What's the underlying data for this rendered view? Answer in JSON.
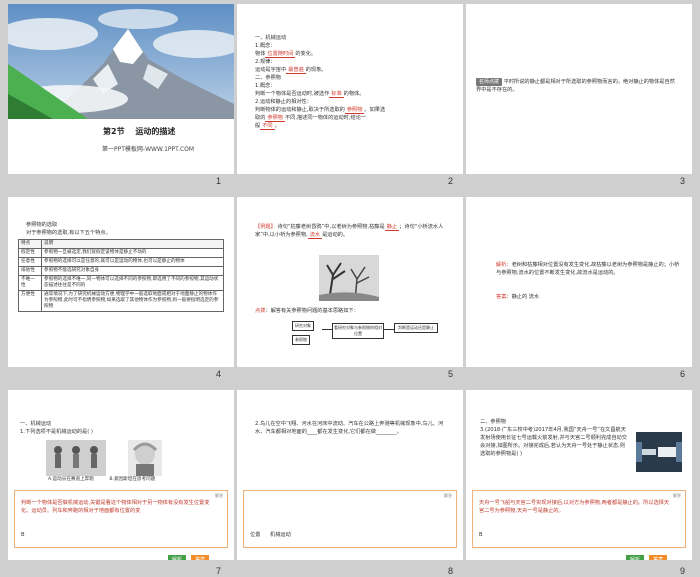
{
  "slide_numbers": [
    "1",
    "2",
    "3",
    "4",
    "5",
    "6",
    "7",
    "8",
    "9"
  ],
  "slide1": {
    "lesson_label": "第2节",
    "lesson_title": "运动的描述",
    "site": "第一PPT模板网-WWW.1PPT.COM"
  },
  "slide2": {
    "heading": "一、机械运动",
    "l1": "1.概念：",
    "l2a": "物体",
    "l2b": "位置随时间",
    "l2c": "的变化。",
    "l3": "2.规律：",
    "l4a": "运动是宇宙中",
    "l4b": "最普遍",
    "l4c": "的现象。",
    "h2": "二、参照物",
    "l5": "1.概念：",
    "l6a": "判断一个物体是否运动时,被选作",
    "l6b": "标准",
    "l6c": "的物体。",
    "l7": "2.运动和静止的相对性：",
    "l8a": "判断物体的运动和静止,取决于所选取的",
    "l8b": "参照物",
    "l8c": "。如果选",
    "l9a": "取的",
    "l9b": "参照物",
    "l9c": "不同,描述同一物体的运动时,结论一",
    "l10a": "般",
    "l10b": "不同",
    "l10c": "。"
  },
  "slide3": {
    "tag": "名师点拨",
    "text": "平时所说的静止都是相对于所选取的参照物而言的，绝对静止的物体是自然界中是不存在的。"
  },
  "slide4": {
    "title": "参照物的选取",
    "intro": "对于参照物的选取,有以下五个特点。",
    "rows": [
      [
        "特点",
        "说明"
      ],
      [
        "假定性",
        "参照物一旦被选定,我们就假定该物体是静止不动的"
      ],
      [
        "任意性",
        "参照物的选择可以是任意的,既可以是运动的物体,也可以是静止的物体"
      ],
      [
        "排他性",
        "参照物不能选研究对象自身"
      ],
      [
        "不唯一性",
        "参照物的选择不唯一,同一物体可以选择不同的参照物,即选用了不同的参照物,其运动状态描述往往是不同的"
      ],
      [
        "方便性",
        "通常情况下,为了研究机械运动方便,物理学中一般选取地面或相对于地面静止的物体作为参照物,此时可不指明参照物,如果选取了其他物体作为参照物,则一般要指明选定的参照物"
      ]
    ]
  },
  "slide5": {
    "tag": "【例题】",
    "text1": "诗句“枯藤老树昏鸦”中,以老树为参照物,枯藤是",
    "blank1": "静止",
    "text2": "；诗句“小桥流水人家”中,以小桥为参照物,",
    "blank2": "流水",
    "text3": "是运动的。",
    "think_tag": "点拨",
    "think_text": "：解答有关参照物问题的基本思路如下：",
    "flow": [
      "研究对象",
      "参照物",
      "看研究对象与参照物的相对位置",
      "判断是运动还是静止"
    ]
  },
  "slide6": {
    "jiexi_label": "解析",
    "jiexi_text": "：老树和枯藤相对位置没有发生变化,故枯藤以老树为参照物是静止的；小桥与参照物,流水的位置不断发生变化,故流水是运动的。",
    "answer_label": "答案",
    "answer_text": "：静止的   流水"
  },
  "slide7": {
    "heading": "一、机械运动",
    "question": "1.下列选项不是机械运动的是(    )",
    "caption_a": "A.运动员在赛道上奔跑",
    "caption_b": "B.爱因斯坦在思考问题",
    "note_label": "解答",
    "explain": "判断一个物体是否做机械运动,关键是看这个物体相对于另一物体有没有发生位置变化。运动员、列车和奔跑的相对于地面都有位置的变",
    "answer": "B",
    "btn_jiexi": "解析",
    "btn_daan": "答案"
  },
  "slide8": {
    "question": "2.鸟儿在空中飞翔、河水在河床中流动、汽车在公路上奔驰等机械现象中,鸟儿、河水、汽车都相对地面的",
    "blank": "____",
    "question_end": "都在发生变化,它们都在做",
    "blank2": "________",
    "period": "。",
    "note_label": "解答",
    "answer1": "位置",
    "answer2": "机械运动"
  },
  "slide9": {
    "heading": "二、参照物",
    "question": "3.(2018·广东三校中考)2017年4月,我国“天舟一号”在文昌航天发射场使用长征七号运载火箭发射,并与天宫二号顺利完成自动交会对接,如图所示。对接完成后,若认为天舟一号处于静止状态,则选取的参照物是(    )",
    "note_label": "解答",
    "explain": "天舟一号飞船与天宫二号实现对接后,以对方为参照物,两者都是静止的。所以选择天宫二号为参照物,天舟一号是静止的。",
    "answer": "B",
    "btn_jiexi": "解析",
    "btn_daan": "答案"
  }
}
